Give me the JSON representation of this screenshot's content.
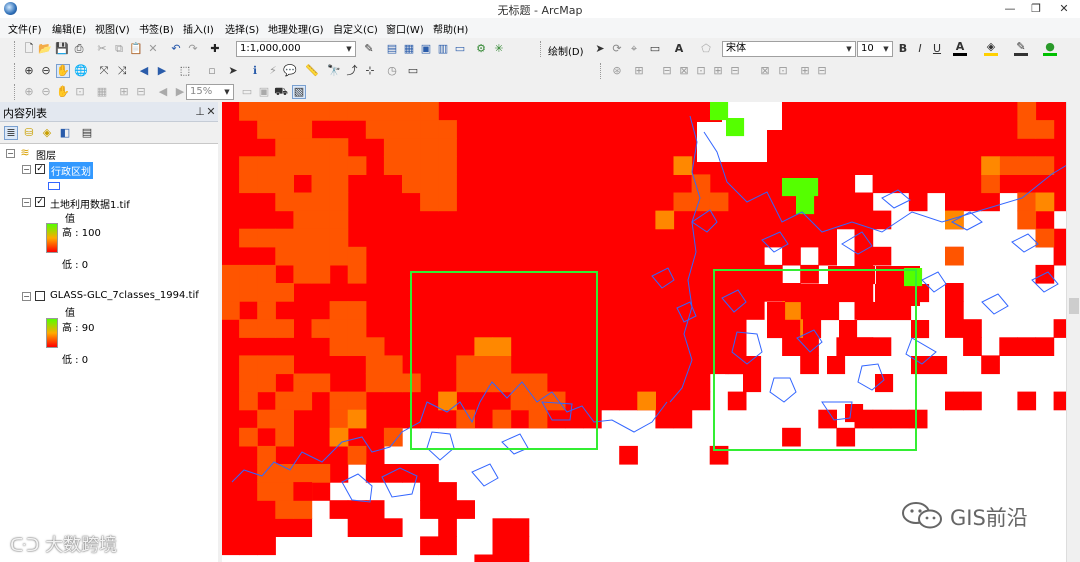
{
  "window": {
    "title": "无标题 - ArcMap"
  },
  "menu": [
    "文件(F)",
    "编辑(E)",
    "视图(V)",
    "书签(B)",
    "插入(I)",
    "选择(S)",
    "地理处理(G)",
    "自定义(C)",
    "窗口(W)",
    "帮助(H)"
  ],
  "toolbar": {
    "scale": "1:1,000,000",
    "draw_label": "绘制(D)",
    "font_name": "宋体",
    "font_size": "10",
    "zoom_pct": "15%",
    "bold": "B",
    "italic": "I",
    "underline": "U",
    "text_tool": "A"
  },
  "toc": {
    "title": "内容列表",
    "root": "图层",
    "layers": [
      {
        "name": "行政区划",
        "checked": true
      },
      {
        "name": "土地利用数据1.tif",
        "checked": true,
        "value_label": "值",
        "high": "高 : 100",
        "low": "低 : 0"
      },
      {
        "name": "GLASS-GLC_7classes_1994.tif",
        "checked": false,
        "value_label": "值",
        "high": "高 : 90",
        "low": "低 : 0"
      }
    ]
  },
  "colors": {
    "red": "#ff0000",
    "orange": "#ff5500",
    "orange2": "#ff8800",
    "green": "#55ff00",
    "boundary": "#3366ff",
    "selection": "#33ee33"
  },
  "watermarks": {
    "left": "大数跨境",
    "right": "GIS前沿"
  }
}
